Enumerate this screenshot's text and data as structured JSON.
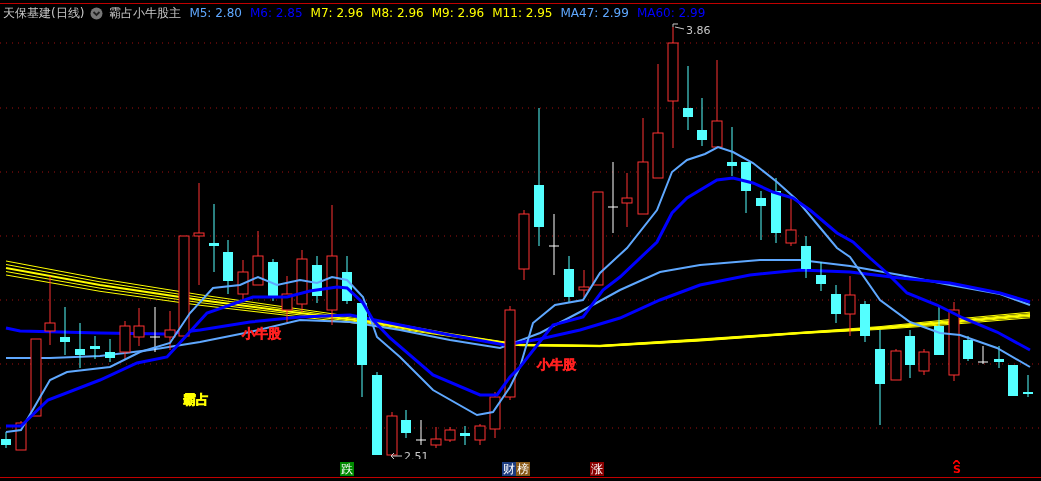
{
  "header": {
    "title": "天保基建(日线)",
    "formula": "霸占小牛股主",
    "indicators": [
      {
        "label": "M5: 2.80",
        "color": "#5fa8ff"
      },
      {
        "label": "M6: 2.85",
        "color": "#0000ff"
      },
      {
        "label": "M7: 2.96",
        "color": "#ffff00"
      },
      {
        "label": "M8: 2.96",
        "color": "#ffff00"
      },
      {
        "label": "M9: 2.96",
        "color": "#ffff00"
      },
      {
        "label": "M11: 2.95",
        "color": "#ffff00"
      },
      {
        "label": "MA47: 2.99",
        "color": "#5fa8ff"
      },
      {
        "label": "MA60: 2.99",
        "color": "#0000ff"
      }
    ]
  },
  "chart": {
    "labels": [
      {
        "text": "小牛股",
        "color": "#ff2020"
      },
      {
        "text": "小牛股",
        "color": "#ff2020"
      },
      {
        "text": "霸占",
        "color": "#ffff00"
      }
    ],
    "high_label": "3.86",
    "low_label": "2.51"
  },
  "markers": [
    {
      "kind": "tag",
      "text": "跌",
      "color": "#008a00"
    },
    {
      "kind": "tag",
      "text": "财",
      "color": "#1c3c80"
    },
    {
      "kind": "tag",
      "text": "榜",
      "color": "#8a5a18"
    },
    {
      "kind": "tag",
      "text": "涨",
      "color": "#8a0000"
    },
    {
      "kind": "signal",
      "text": "S",
      "color": "#ff0000"
    }
  ]
}
